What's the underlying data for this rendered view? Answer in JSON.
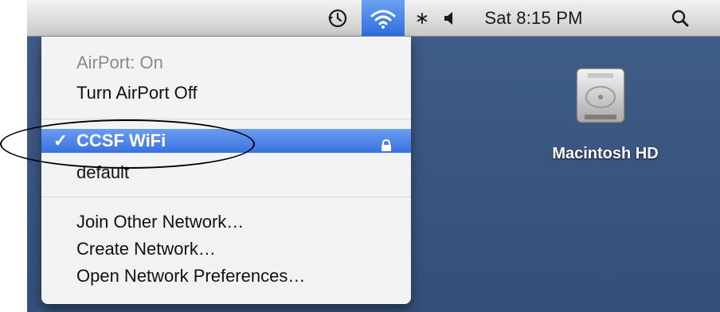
{
  "menubar": {
    "clock": "Sat 8:15 PM",
    "icons": {
      "time_machine": "time-machine-icon",
      "wifi": "wifi-icon",
      "bluetooth": "bluetooth-icon",
      "volume": "volume-icon",
      "search": "spotlight-search-icon"
    },
    "bluetooth_glyph": "∗",
    "active_accent": "#3a73df"
  },
  "airport_menu": {
    "status": "AirPort: On",
    "toggle_label": "Turn AirPort Off",
    "networks": [
      {
        "name": "CCSF WiFi",
        "checked": true,
        "secured": true,
        "check_glyph": "✓"
      },
      {
        "name": "default",
        "checked": false,
        "secured": false
      }
    ],
    "actions": [
      "Join Other Network…",
      "Create Network…",
      "Open Network Preferences…"
    ]
  },
  "desktop": {
    "background_color": "#3a5680",
    "items": [
      {
        "label": "Macintosh HD",
        "icon": "hard-drive-icon"
      }
    ]
  }
}
